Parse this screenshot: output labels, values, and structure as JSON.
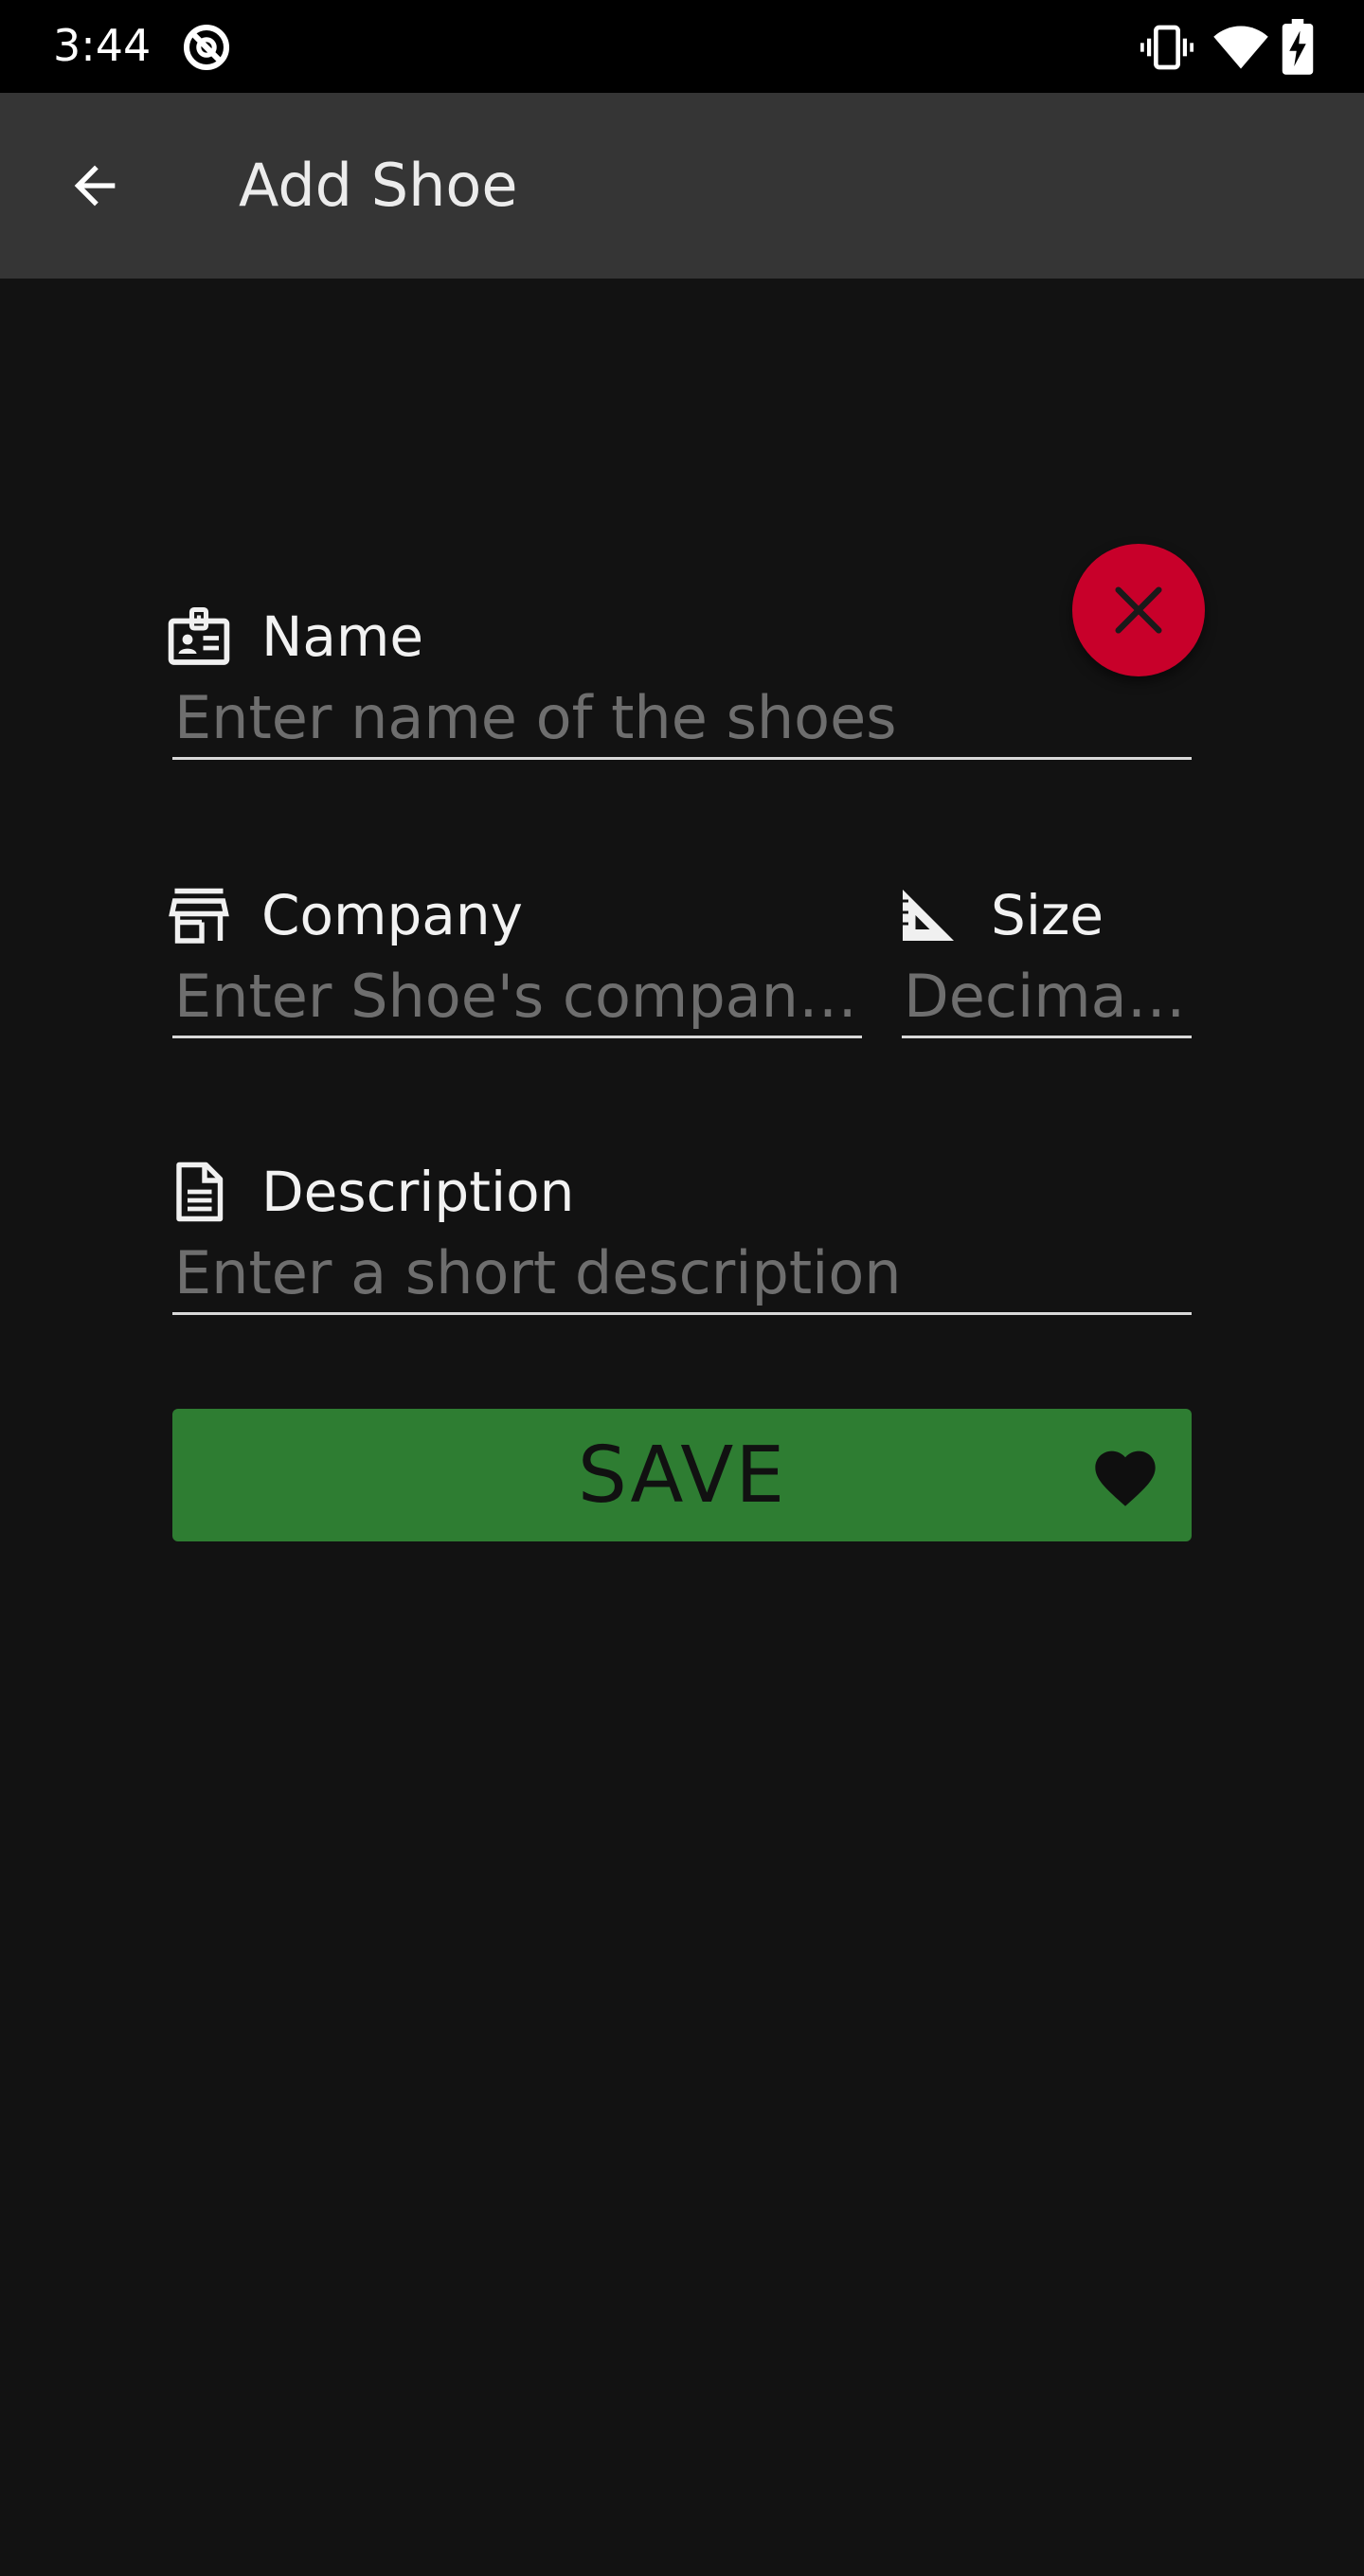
{
  "status_bar": {
    "time": "3:44",
    "icons": [
      "app-notification-icon",
      "vibrate-icon",
      "wifi-icon",
      "battery-charging-icon"
    ]
  },
  "app_bar": {
    "back_icon": "arrow-back-icon",
    "title": "Add Shoe"
  },
  "form": {
    "name": {
      "label": "Name",
      "icon": "badge-icon",
      "placeholder": "Enter name of the shoes",
      "value": ""
    },
    "company": {
      "label": "Company",
      "icon": "store-icon",
      "placeholder": "Enter Shoe's company name",
      "value": ""
    },
    "size": {
      "label": "Size",
      "icon": "ruler-triangle-icon",
      "placeholder": "Decimal size",
      "value": ""
    },
    "description": {
      "label": "Description",
      "icon": "document-icon",
      "placeholder": "Enter a short description",
      "value": ""
    },
    "cancel_icon": "close-icon",
    "save": {
      "label": "SAVE",
      "icon": "heart-icon"
    }
  },
  "colors": {
    "background": "#121212",
    "app_bar": "#353535",
    "cancel_fab": "#c8002a",
    "save_button": "#2e7d32"
  }
}
